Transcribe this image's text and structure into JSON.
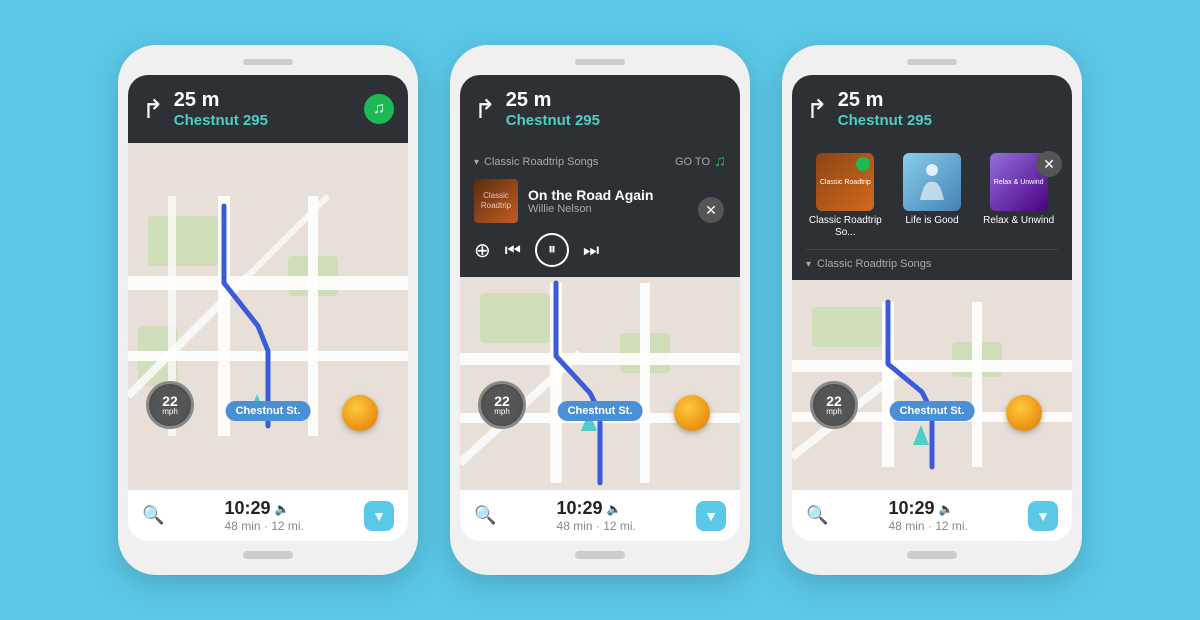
{
  "bg_color": "#5bc8e8",
  "phones": [
    {
      "id": "phone1",
      "nav": {
        "distance": "25 m",
        "street": "Chestnut 295",
        "has_spotify": true
      },
      "bottom": {
        "time": "10:29",
        "eta": "48 min · 12 mi.",
        "search_label": "🔍",
        "chevron_label": "▼"
      },
      "speed": "22",
      "speed_unit": "mph",
      "street_label": "Chestnut St."
    },
    {
      "id": "phone2",
      "nav": {
        "distance": "25 m",
        "street": "Chestnut 295"
      },
      "spotify_overlay": {
        "playlist": "Classic Roadtrip Songs",
        "go_to": "GO TO",
        "track_name": "On the Road Again",
        "artist": "Willie Nelson",
        "album_label": "Classic Roadtrip Songs"
      },
      "bottom": {
        "time": "10:29",
        "eta": "48 min · 12 mi."
      },
      "speed": "22",
      "speed_unit": "mph",
      "street_label": "Chestnut St."
    },
    {
      "id": "phone3",
      "nav": {
        "distance": "25 m",
        "street": "Chestnut 295"
      },
      "playlist_browser": {
        "cards": [
          {
            "label": "Classic Roadtrip So...",
            "type": "roadtrip",
            "active": true
          },
          {
            "label": "Life is Good",
            "type": "lifeisgood",
            "active": false
          },
          {
            "label": "Relax & Unwind",
            "type": "relax",
            "active": false
          }
        ],
        "current_playlist": "Classic Roadtrip Songs"
      },
      "bottom": {
        "time": "10:29",
        "eta": "48 min · 12 mi."
      },
      "speed": "22",
      "speed_unit": "mph",
      "street_label": "Chestnut St."
    }
  ]
}
